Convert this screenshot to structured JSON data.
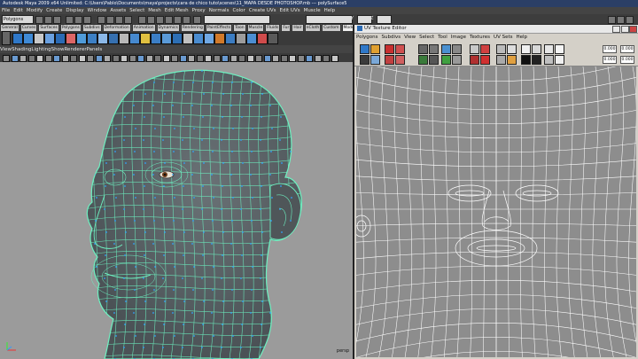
{
  "window": {
    "title": "Autodesk Maya 2009 x64 Unlimited: C:\\Users\\Pablo\\Documents\\maya\\projects\\cara de chico tuto\\scenes\\11_MAPA DESDE PHOTOSHOP.mb  ---  polySurface5"
  },
  "menubar": {
    "items": [
      "File",
      "Edit",
      "Modify",
      "Create",
      "Display",
      "Window",
      "Assets",
      "Select",
      "Mesh",
      "Edit Mesh",
      "Proxy",
      "Normals",
      "Color",
      "Create UVs",
      "Edit UVs",
      "Muscle",
      "Help"
    ]
  },
  "status_line": {
    "mode_dropdown": "Polygons",
    "coord_y_label": "Y",
    "coord_z_label": "Z"
  },
  "shelf": {
    "tabs": [
      "General",
      "Curves",
      "Surfaces",
      "Polygons",
      "Subdivs",
      "Deformation",
      "Animation",
      "Dynamics",
      "Rendering",
      "PaintEffects",
      "Toon",
      "Muscle",
      "Fluids",
      "Fur",
      "Hair",
      "nCloth",
      "Custom",
      "Modelado"
    ],
    "active_tab": "Modelado"
  },
  "viewport": {
    "menu": [
      "View",
      "Shading",
      "Lighting",
      "Show",
      "Renderer",
      "Panels"
    ],
    "camera_label": "persp"
  },
  "uv_editor": {
    "title": "UV Texture Editor",
    "menu": [
      "Polygons",
      "Subdivs",
      "View",
      "Select",
      "Tool",
      "Image",
      "Textures",
      "UV Sets",
      "Help"
    ],
    "field_values": [
      "0.000",
      "0.000",
      "0.000",
      "0.000"
    ]
  },
  "colors": {
    "wire": "#6df0c0",
    "mesh": "#5c6468",
    "uv_bg": "#8d8d8d",
    "uv_line": "#ffffff",
    "title_bar": "#2b3f66"
  }
}
